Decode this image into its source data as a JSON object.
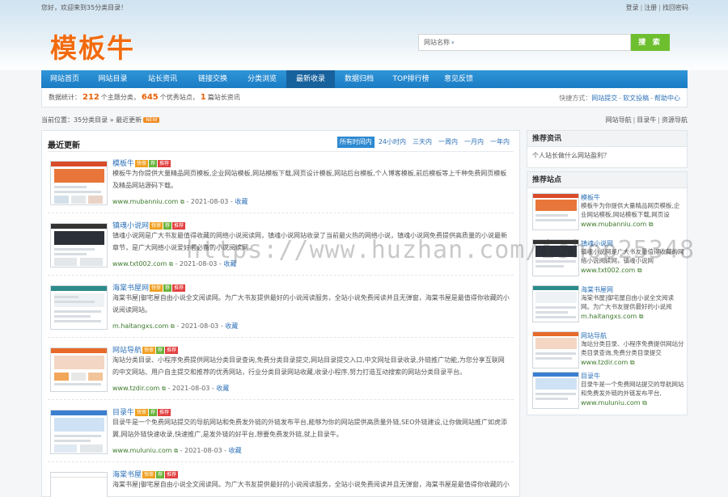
{
  "header": {
    "welcome": "您好，欢迎来到35分类目录！",
    "login": "登录",
    "register": "注册",
    "find_password": "找回密码",
    "logo": "模板牛",
    "search_category": "网站名称",
    "search_placeholder": "",
    "search_button": "搜 索"
  },
  "nav": {
    "items": [
      "网站首页",
      "网站目录",
      "站长资讯",
      "链接交换",
      "分类浏览",
      "最新收录",
      "数据归档",
      "TOP排行榜",
      "意见反馈"
    ],
    "active": "最新收录"
  },
  "stats": {
    "prefix": "数据统计：",
    "topics": "212",
    "topics_label": "个主题分类，",
    "sites": "645",
    "sites_label": "个优秀站点，",
    "articles": "1",
    "articles_label": "篇站长资讯",
    "quick_label": "快捷方式：",
    "quick_links": [
      "网站提交",
      "软文投稿",
      "帮助中心"
    ]
  },
  "breadcrumb": {
    "label": "当前位置：35分类目录 » 最近更新",
    "badge": "NEW",
    "side_links": [
      "网站导航",
      "目录牛",
      "资源导航"
    ]
  },
  "main": {
    "title": "最近更新",
    "time_tabs": [
      "所有时间内",
      "24小时内",
      "三天内",
      "一周内",
      "一月内",
      "一年内"
    ],
    "active_tab": "所有时间内",
    "favorite_label": "收藏",
    "items": [
      {
        "name": "模板牛",
        "tags": [
          "快审",
          "荐",
          "推荐"
        ],
        "desc": "模板牛为你提供大量精品网页模板,企业网站模板,网站模板下载,网页设计模板,网站后台模板,个人博客模板,前后模板等上千种免费网页模板及精品网站源码下载。",
        "url": "www.mubanniu.com",
        "date": "2021-08-03"
      },
      {
        "name": "镇魂小说网",
        "tags": [
          "快审",
          "荐",
          "推荐"
        ],
        "desc": "镇魂小说网是广大书友最值得收藏的网络小说阅读网，镇魂小说网站收录了当前最火热的网络小说，镇魂小说网免费提供高质量的小说最新章节，是广大网络小说爱好者必备的小说阅读网。",
        "url": "www.txt002.com",
        "date": "2021-08-03"
      },
      {
        "name": "海棠书屋网",
        "tags": [
          "快审",
          "荐",
          "推荐"
        ],
        "desc": "海棠书屋|御宅屋自由小说全文阅读网。为广大书友提供最好的小说阅读服务，全站小说免费阅读并且无弹窗，海棠书屋是最值得你收藏的小说阅读网站。",
        "url": "m.haitangxs.com",
        "date": "2021-08-03"
      },
      {
        "name": "网站导航",
        "tags": [
          "快审",
          "荐",
          "推荐"
        ],
        "desc": "淘站分类目录、小程序免费提供网站分类目录查询,免费分类目录提交,网站目录提交入口,中文网址目录收录,外链推广功能,为您分享互联网的中文网站、用户自主提交和推荐的优秀网站，行业分类目录网站收藏,收录小程序,努力打造互动搜索的网站分类目录平台。",
        "url": "www.tzdir.com",
        "date": "2021-08-03"
      },
      {
        "name": "目录牛",
        "tags": [
          "快审",
          "荐",
          "推荐"
        ],
        "desc": "目录牛是一个免费网站提交的导航网站和免费发外链的外链发布平台,能够为你的网站提供高质量外链,SEO外链建设,让你做网站推广如虎添翼,网站外链快速收录,快速推广,是发外链的好平台,想要免费发外链,就上目录牛。",
        "url": "www.muluniu.com",
        "date": "2021-08-03"
      },
      {
        "name": "海棠书屋",
        "tags": [
          "快审",
          "荐",
          "推荐"
        ],
        "desc": "海棠书屋|御宅屋自由小说全文阅读网。为广大书友提供最好的小说阅读服务，全站小说免费阅读并且无弹窗，海棠书屋是最值得你收藏的小说阅读网站。",
        "url": "",
        "date": ""
      }
    ]
  },
  "sidebar": {
    "news_title": "推荐资讯",
    "news": [
      "个人站长做什么网站盈利？"
    ],
    "rec_title": "推荐站点",
    "rec": [
      {
        "name": "模板牛",
        "desc": "模板牛为你提供大量精品网页模板,企业网站模板,网站模板下载,网页设",
        "url": "www.mubanniu.com"
      },
      {
        "name": "镇魂小说网",
        "desc": "镇魂小说网是广大书友最值得收藏的网络小说阅读网，镇魂小说网",
        "url": "www.txt002.com"
      },
      {
        "name": "海棠书屋网",
        "desc": "海棠书屋|御宅屋自由小说全文阅读网。为广大书友提供最好的小说阅",
        "url": "m.haitangxs.com"
      },
      {
        "name": "网站导航",
        "desc": "淘站分类目录、小程序免费提供网站分类目录查询,免费分类目录提交",
        "url": "www.tzdir.com"
      },
      {
        "name": "目录牛",
        "desc": "目录牛是一个免费网站提交的导航网站和免费发外链的外链发布平台,",
        "url": "www.muluniu.com"
      }
    ]
  },
  "watermark": "https://www.huzhan.com/ishop25348",
  "colors": {
    "nav": "#1b7cc4",
    "nav_active": "#17619d",
    "logo": "#f26b0f",
    "link": "#2e72b8",
    "url_green": "#3d7a2c",
    "search_btn": "#6dbf2f",
    "stat_num": "#e8600a"
  },
  "icons": {
    "external_link": "external-link-icon",
    "chevron": "chevron-down-icon"
  }
}
